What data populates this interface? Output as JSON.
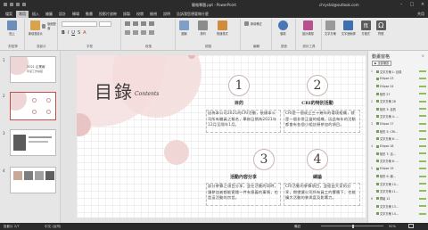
{
  "titlebar": {
    "title": "簡報專題.ppt - PowerPoint",
    "account": "chrystal@outlook.com"
  },
  "tabs": [
    "檔案",
    "常用",
    "插入",
    "繪圖",
    "設計",
    "轉場",
    "動畫",
    "投影片放映",
    "錄製",
    "校閱",
    "檢視",
    "說明",
    "告訴我您想要做什麼"
  ],
  "tabs_active_index": 1,
  "share_label": "共用",
  "ribbon": {
    "groups": [
      {
        "label": "剪貼簿",
        "buttons": [
          "貼上"
        ]
      },
      {
        "label": "投影片",
        "buttons": [
          "新增投影片"
        ]
      },
      {
        "label": "字型",
        "buttons": []
      },
      {
        "label": "段落",
        "buttons": []
      },
      {
        "label": "繪圖",
        "buttons": [
          "圖案",
          "排列",
          "快速樣式"
        ]
      },
      {
        "label": "編輯",
        "buttons": []
      },
      {
        "label": "語音",
        "buttons": [
          "聽寫"
        ]
      },
      {
        "label": "設計工具",
        "buttons": [
          "設計構想"
        ]
      }
    ],
    "right_items": [
      "文字方塊",
      "文字藝術師",
      "方程式",
      "符號"
    ],
    "extra_labels": [
      "新增備註",
      "版面配置"
    ]
  },
  "thumbs": [
    {
      "num": "1",
      "title_line1": "2021 企業報",
      "title_line2": "年度工作總結"
    },
    {
      "num": "2",
      "title_line1": "",
      "title_line2": ""
    },
    {
      "num": "3",
      "title_line1": "",
      "title_line2": ""
    },
    {
      "num": "4",
      "title_line1": "",
      "title_line2": ""
    }
  ],
  "slide": {
    "main_title": "目錄",
    "main_title_sub": "Contents",
    "sections": [
      {
        "num": "1",
        "title": "目的",
        "body": "因為本公司2021的CRI活動，依據本公司所有職員之報名，舉辦日期為2021年12月至隔年1月。"
      },
      {
        "num": "2",
        "title": "CRI的特別活動",
        "body": "CRI是一個成立三十幾年的環境組織，就是一個非常正當的組織，因此每年的活動都會有各個小組註冊參加的項目。"
      },
      {
        "num": "3",
        "title": "活動內容分享",
        "body": "部分參賽之項目分享，並在活動的同時，讓參加者都能實踐一件有意義的事情，也是這活動的宗旨。"
      },
      {
        "num": "4",
        "title": "總論",
        "body": "CRI活動的參賽項目，並經由大家的分享，期望讓公司所有員工的響應下，也能擴大活動的參與度及影響力。"
      }
    ]
  },
  "anim_pane": {
    "title": "動畫窗格",
    "close": "×",
    "play_label": "▶ 全部播放",
    "items": [
      {
        "n": "1",
        "label": "文字方塊 1: 目錄"
      },
      {
        "n": "",
        "label": "Ellipse 23"
      },
      {
        "n": "",
        "label": "Ellipse 24"
      },
      {
        "n": "",
        "label": "矩形 27"
      },
      {
        "n": "2",
        "label": "文字方塊 28"
      },
      {
        "n": "",
        "label": "矩形 3: 目的"
      },
      {
        "n": "",
        "label": "文字方塊 4: ..."
      },
      {
        "n": "3",
        "label": "Ellipse 17"
      },
      {
        "n": "",
        "label": "矩形 5: CRI..."
      },
      {
        "n": "",
        "label": "文字方塊 6: ..."
      },
      {
        "n": "4",
        "label": "Ellipse 18"
      },
      {
        "n": "",
        "label": "矩形 7: 活..."
      },
      {
        "n": "",
        "label": "文字方塊 8: ..."
      },
      {
        "n": "5",
        "label": "Ellipse 19"
      },
      {
        "n": "",
        "label": "矩形 9: 總..."
      },
      {
        "n": "",
        "label": "文字方塊 10..."
      },
      {
        "n": "",
        "label": "文字方塊 11..."
      },
      {
        "n": "6",
        "label": "群組 12"
      },
      {
        "n": "",
        "label": "文字方塊 13..."
      },
      {
        "n": "",
        "label": "文字方塊 14..."
      }
    ]
  },
  "statusbar": {
    "slide_info": "投影片 2/7",
    "lang": "中文 (台灣)",
    "notes": "備註",
    "zoom": "92%"
  },
  "colors": {
    "accent_pink": "#e9c4c4",
    "accent_dark_pink": "#d8a3a3",
    "ribbon_bg": "#e9e9e9",
    "titlebar_bg": "#2b2b2b"
  }
}
